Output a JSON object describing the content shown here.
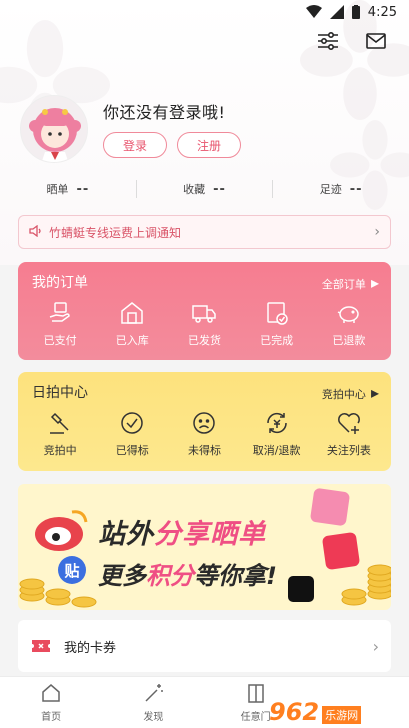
{
  "status_bar": {
    "time": "4:25"
  },
  "profile": {
    "title": "你还没有登录哦!",
    "login_label": "登录",
    "register_label": "注册"
  },
  "stats": [
    {
      "label": "晒单",
      "value": "--"
    },
    {
      "label": "收藏",
      "value": "--"
    },
    {
      "label": "足迹",
      "value": "--"
    }
  ],
  "notice": {
    "text": "竹蜻蜓专线运费上调通知"
  },
  "orders": {
    "title": "我的订单",
    "link": "全部订单",
    "items": [
      {
        "label": "已支付",
        "icon": "hand-coin-icon"
      },
      {
        "label": "已入库",
        "icon": "warehouse-icon"
      },
      {
        "label": "已发货",
        "icon": "truck-icon"
      },
      {
        "label": "已完成",
        "icon": "check-doc-icon"
      },
      {
        "label": "已退款",
        "icon": "piggy-bank-icon"
      }
    ]
  },
  "auction": {
    "title": "日拍中心",
    "link": "竞拍中心",
    "items": [
      {
        "label": "竞拍中",
        "icon": "gavel-icon"
      },
      {
        "label": "已得标",
        "icon": "check-circle-icon"
      },
      {
        "label": "未得标",
        "icon": "sad-face-icon"
      },
      {
        "label": "取消/退款",
        "icon": "refund-icon"
      },
      {
        "label": "关注列表",
        "icon": "heart-plus-icon"
      }
    ]
  },
  "banner": {
    "line1_a": "站外",
    "line1_b": "分享",
    "line1_c": "晒单",
    "line2_a": "更多",
    "line2_b": "积分",
    "line2_c": "等你拿!",
    "tag": "贴"
  },
  "voucher": {
    "label": "我的卡券"
  },
  "tabbar": [
    {
      "label": "首页",
      "icon": "home-icon"
    },
    {
      "label": "发现",
      "icon": "magic-wand-icon"
    },
    {
      "label": "任意门",
      "icon": "door-icon"
    },
    {
      "label": "",
      "icon": ""
    }
  ],
  "watermark": {
    "num": "962",
    "sub": "乐游网"
  },
  "colors": {
    "accent": "#f67d90",
    "auction_bg": "#fde27d",
    "notice_text": "#d95468"
  }
}
